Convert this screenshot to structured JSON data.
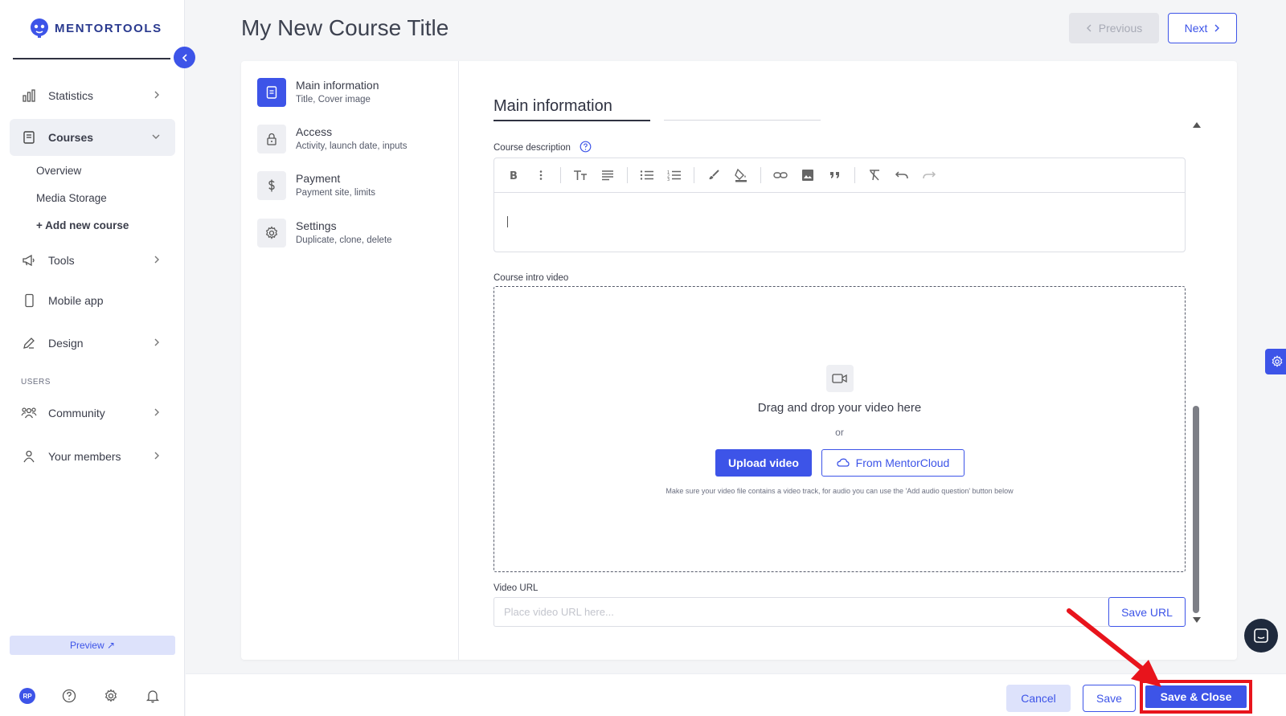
{
  "brand": {
    "name": "MENTORTOOLS"
  },
  "sidebar": {
    "items": [
      {
        "label": "Statistics",
        "icon": "bar-chart-icon"
      },
      {
        "label": "Courses",
        "icon": "book-icon"
      },
      {
        "label": "Tools",
        "icon": "megaphone-icon"
      },
      {
        "label": "Mobile app",
        "icon": "phone-icon"
      },
      {
        "label": "Design",
        "icon": "pencil-icon"
      },
      {
        "label": "Community",
        "icon": "people-icon"
      },
      {
        "label": "Your members",
        "icon": "user-icon"
      }
    ],
    "courses_sub": [
      "Overview",
      "Media Storage",
      "+ Add new course"
    ],
    "section_users": "USERS",
    "preview_label": "Preview ↗",
    "avatar_initials": "RP"
  },
  "header": {
    "title": "My New Course Title",
    "previous_label": "Previous",
    "next_label": "Next"
  },
  "steps": [
    {
      "title": "Main information",
      "subtitle": "Title, Cover image",
      "icon": "document-icon",
      "active": true
    },
    {
      "title": "Access",
      "subtitle": "Activity, launch date, inputs",
      "icon": "lock-icon",
      "active": false
    },
    {
      "title": "Payment",
      "subtitle": "Payment site, limits",
      "icon": "dollar-icon",
      "active": false
    },
    {
      "title": "Settings",
      "subtitle": "Duplicate, clone, delete",
      "icon": "gear-icon",
      "active": false
    }
  ],
  "main": {
    "section_title": "Main information",
    "description_label": "Course description",
    "intro_video_label": "Course intro video",
    "dropzone": {
      "text": "Drag and drop your video here",
      "or": "or",
      "upload_label": "Upload video",
      "cloud_label": "From MentorCloud",
      "note": "Make sure your video file contains a video track, for audio you can use the 'Add audio question' button below"
    },
    "video_url_label": "Video URL",
    "video_url_placeholder": "Place video URL here...",
    "save_url_label": "Save URL"
  },
  "footer": {
    "cancel_label": "Cancel",
    "save_label": "Save",
    "save_close_label": "Save & Close"
  },
  "colors": {
    "accent": "#3d54e8",
    "highlight": "#e8141c"
  }
}
